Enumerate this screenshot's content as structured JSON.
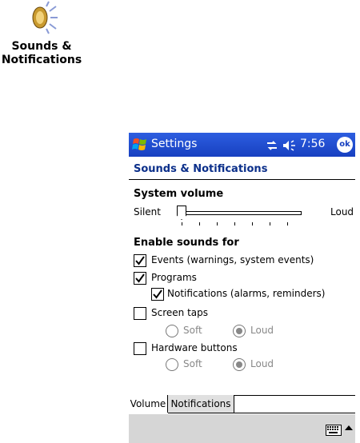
{
  "desktop": {
    "icon_name": "speaker-icon",
    "caption_line1": "Sounds &",
    "caption_line2": "Notifications"
  },
  "titlebar": {
    "title": "Settings",
    "time": "7:56",
    "ok_label": "ok",
    "color": "#1740c0"
  },
  "page": {
    "header": "Sounds & Notifications"
  },
  "volume": {
    "section_label": "System volume",
    "min_label": "Silent",
    "max_label": "Loud",
    "level": 0
  },
  "enable": {
    "section_label": "Enable sounds for",
    "items": [
      {
        "label": "Events (warnings, system events)",
        "checked": true
      },
      {
        "label": "Programs",
        "checked": true
      },
      {
        "label": "Notifications (alarms, reminders)",
        "checked": true
      },
      {
        "label": "Screen taps",
        "checked": false
      },
      {
        "label": "Hardware buttons",
        "checked": false
      }
    ],
    "screen_taps_options": [
      {
        "label": "Soft",
        "selected": false
      },
      {
        "label": "Loud",
        "selected": true
      }
    ],
    "hardware_options": [
      {
        "label": "Soft",
        "selected": false
      },
      {
        "label": "Loud",
        "selected": true
      }
    ]
  },
  "tabs": [
    {
      "label": "Volume",
      "active": true
    },
    {
      "label": "Notifications",
      "active": false
    }
  ]
}
